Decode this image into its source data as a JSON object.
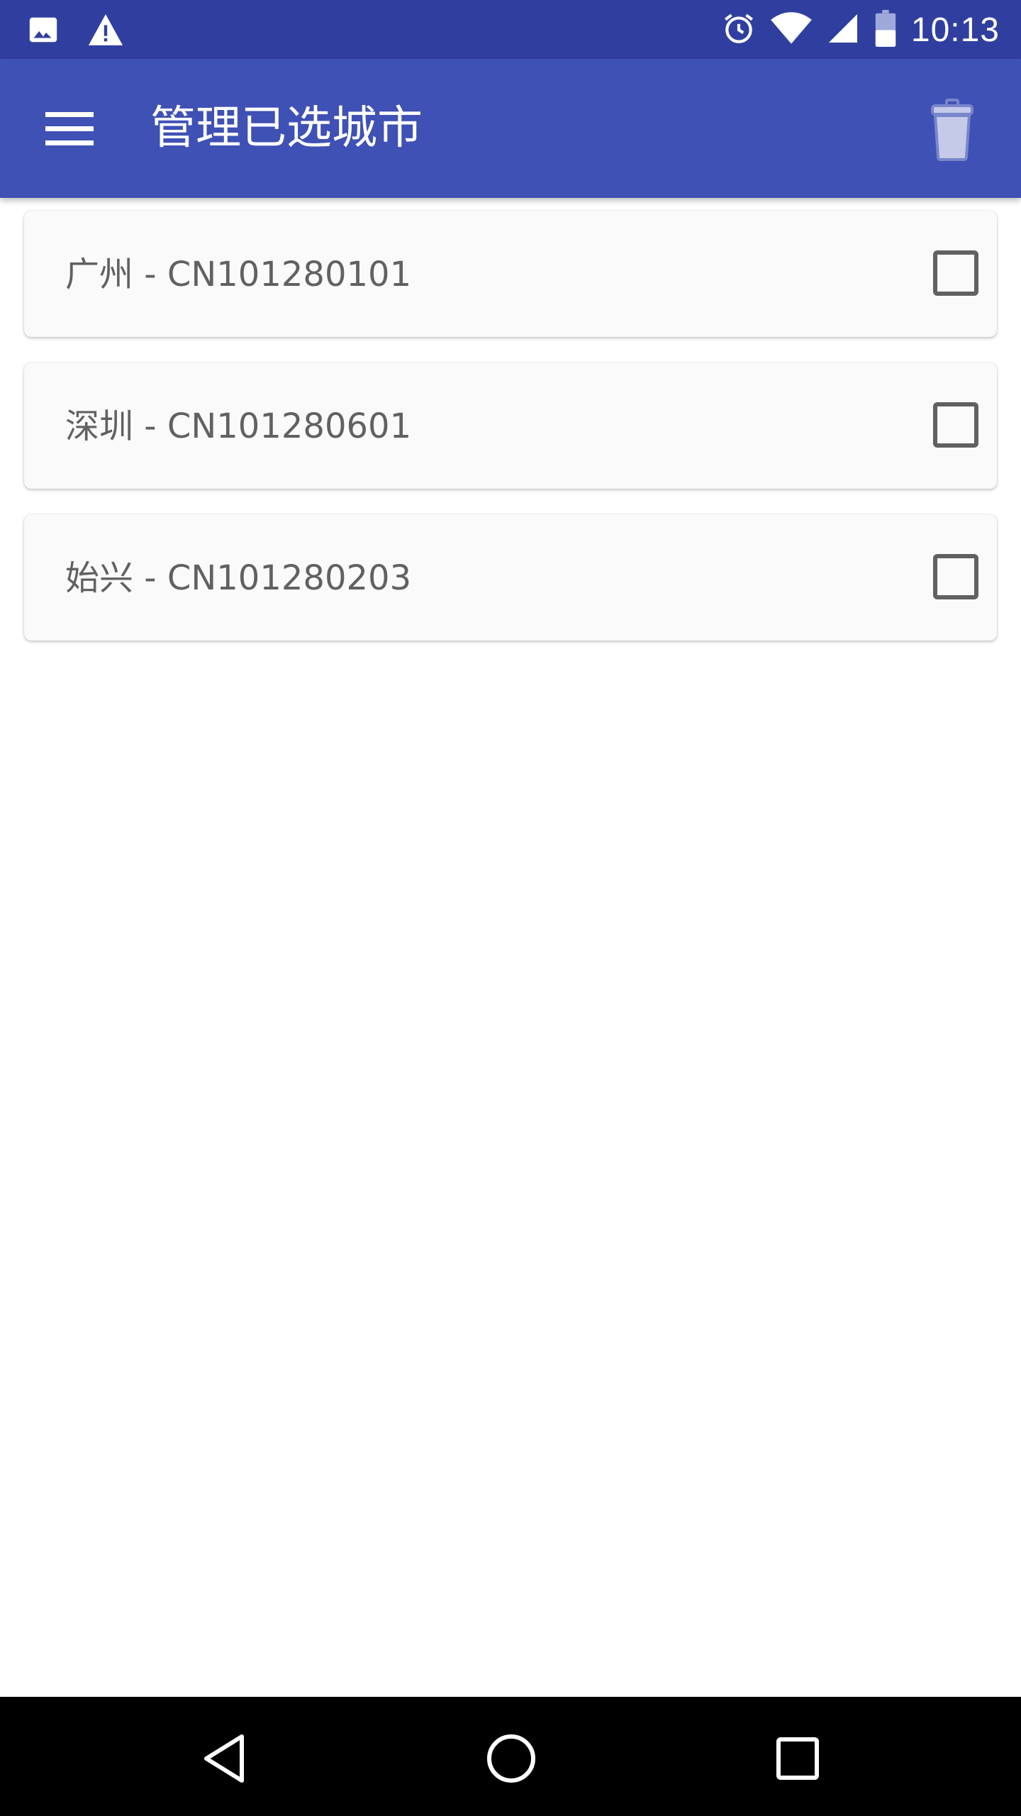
{
  "status_bar": {
    "time": "10:13",
    "icons": [
      "image-icon",
      "warning-icon",
      "alarm-icon",
      "wifi-icon",
      "signal-icon",
      "battery-icon"
    ]
  },
  "app_bar": {
    "title": "管理已选城市",
    "menu_icon": "menu-icon",
    "action_icon": "trash-icon"
  },
  "cities": [
    {
      "label": "广州 - CN101280101",
      "checked": false
    },
    {
      "label": "深圳 - CN101280601",
      "checked": false
    },
    {
      "label": "始兴 - CN101280203",
      "checked": false
    }
  ],
  "nav_bar": {
    "icons": [
      "back-icon",
      "home-icon",
      "recents-icon"
    ]
  },
  "colors": {
    "status_bar": "#303f9f",
    "app_bar": "#3f51b5",
    "card": "#fafafa",
    "text": "#616161"
  }
}
